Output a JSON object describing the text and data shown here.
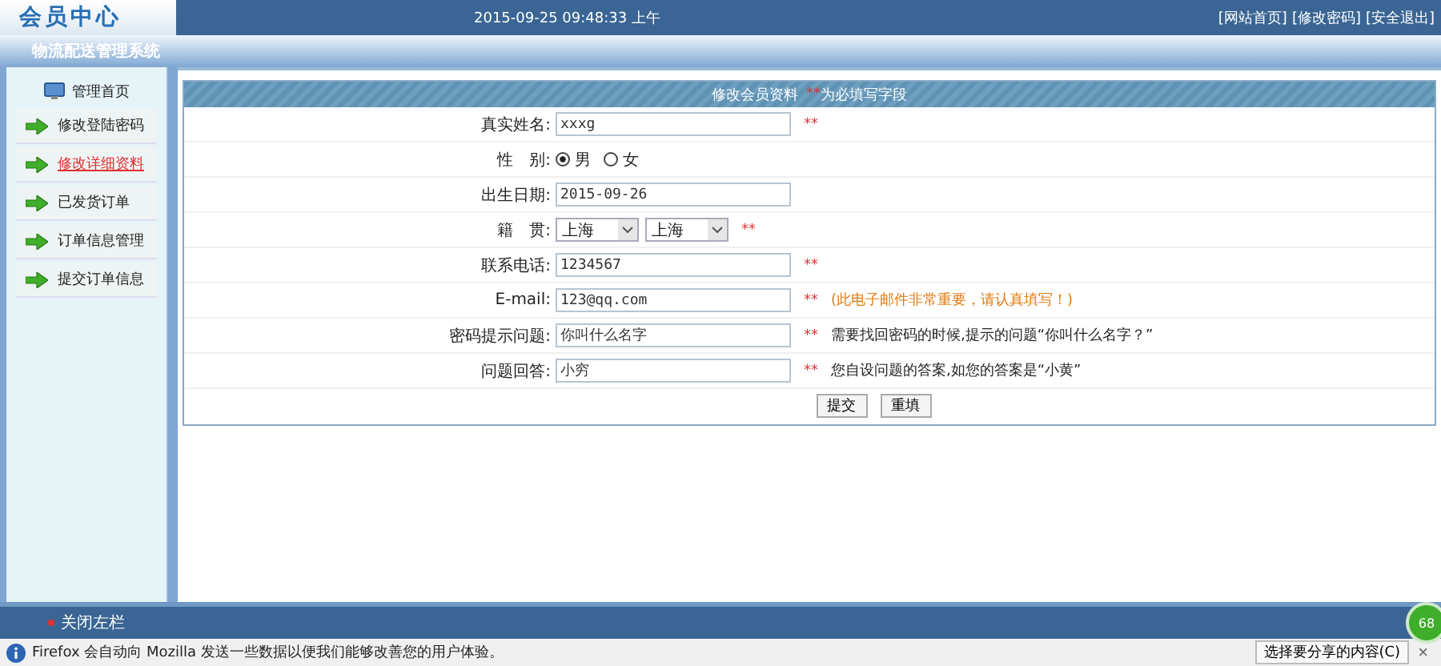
{
  "header": {
    "logo": "会员中心",
    "datetime": "2015-09-25 09:48:33 上午",
    "links": [
      "[网站首页]",
      "[修改密码]",
      "[安全退出]"
    ]
  },
  "system_title": "物流配送管理系统",
  "sidebar": {
    "home": "管理首页",
    "items": [
      {
        "label": "修改登陆密码",
        "selected": false
      },
      {
        "label": "修改详细资料",
        "selected": true
      },
      {
        "label": "已发货订单",
        "selected": false
      },
      {
        "label": "订单信息管理",
        "selected": false
      },
      {
        "label": "提交订单信息",
        "selected": false
      }
    ]
  },
  "form": {
    "title": "修改会员资料",
    "required_mark": "**",
    "required_note": "为必填写字段",
    "rows": [
      {
        "kind": "text",
        "label": "真实姓名:",
        "value": "xxxg",
        "required": true
      },
      {
        "kind": "radio",
        "label": "性　别:",
        "options": [
          {
            "label": "男",
            "selected": true
          },
          {
            "label": "女",
            "selected": false
          }
        ],
        "required": false
      },
      {
        "kind": "text",
        "label": "出生日期:",
        "value": "2015-09-26",
        "required": false
      },
      {
        "kind": "select",
        "label": "籍　贯:",
        "values": [
          "上海",
          "上海"
        ],
        "required": true
      },
      {
        "kind": "text",
        "label": "联系电话:",
        "value": "1234567",
        "required": true
      },
      {
        "kind": "text",
        "label": "E-mail:",
        "value": "123@qq.com",
        "required": true,
        "note": "(此电子邮件非常重要，请认真填写！)",
        "warning": true
      },
      {
        "kind": "text",
        "label": "密码提示问题:",
        "value": "你叫什么名字",
        "required": true,
        "note": "需要找回密码的时候,提示的问题“你叫什么名字？”",
        "warning": false
      },
      {
        "kind": "text",
        "label": "问题回答:",
        "value": "小穷",
        "required": true,
        "note": "您自设问题的答案,如您的答案是“小黄”",
        "warning": false
      }
    ],
    "buttons": [
      "提交",
      "重填"
    ]
  },
  "footer": {
    "toggle": "关闭左栏"
  },
  "notification": {
    "message": "Firefox 会自动向 Mozilla 发送一些数据以便我们能够改善您的用户体验。",
    "share_button": "选择要分享的内容(C)",
    "close": "×"
  },
  "badge": "68"
}
